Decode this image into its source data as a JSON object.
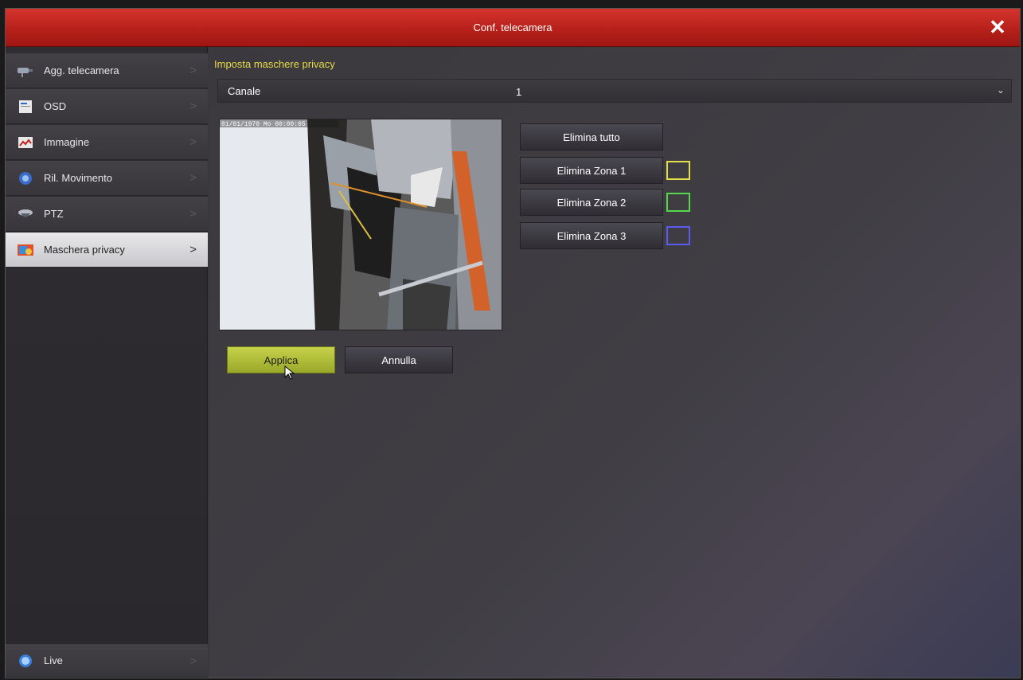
{
  "window": {
    "title": "Conf. telecamera"
  },
  "sidebar": {
    "items": [
      {
        "label": "Agg. telecamera"
      },
      {
        "label": "OSD"
      },
      {
        "label": "Immagine"
      },
      {
        "label": "Ril. Movimento"
      },
      {
        "label": "PTZ"
      },
      {
        "label": "Maschera privacy"
      }
    ],
    "live": {
      "label": "Live"
    }
  },
  "main": {
    "section_title": "Imposta maschere privacy",
    "channel": {
      "label": "Canale",
      "value": "1"
    },
    "preview": {
      "osd_text": "01/01/1970 Mo 00:00:05"
    },
    "buttons": {
      "delete_all": "Elimina tutto",
      "zone1": "Elimina Zona 1",
      "zone2": "Elimina Zona 2",
      "zone3": "Elimina Zona 3",
      "apply": "Applica",
      "cancel": "Annulla"
    },
    "zone_colors": {
      "zone1": "#e2e04a",
      "zone2": "#52d84a",
      "zone3": "#5a5cf0"
    }
  },
  "colors": {
    "titlebar": "#c0241d",
    "section_title": "#e6d94a",
    "apply_button": "#b6c23c"
  }
}
